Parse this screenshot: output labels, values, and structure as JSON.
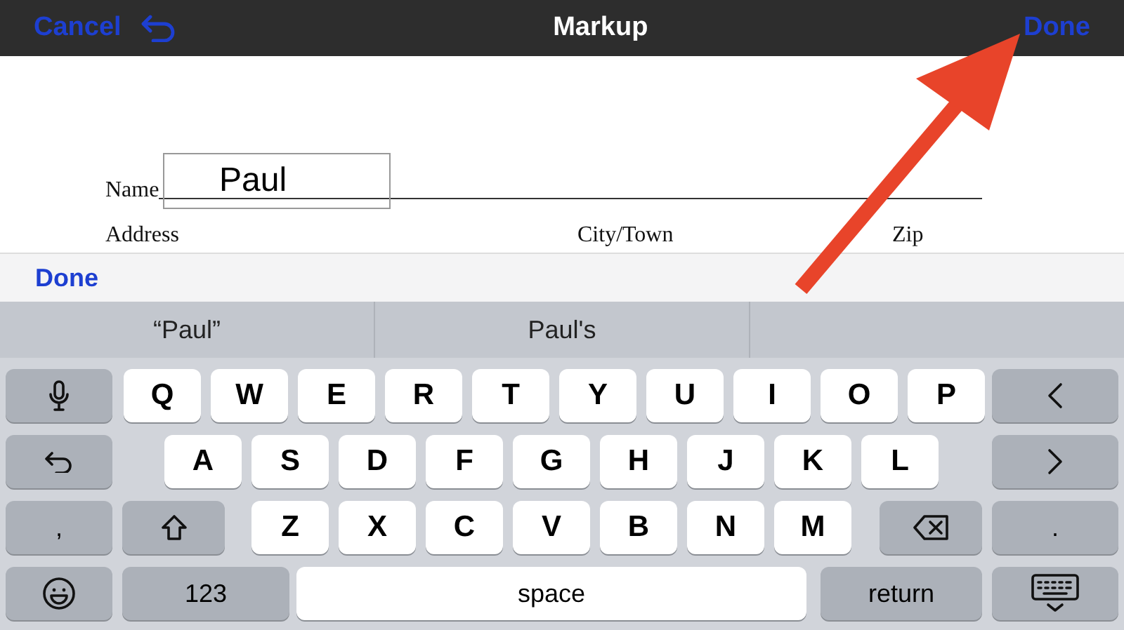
{
  "top_bar": {
    "cancel": "Cancel",
    "title": "Markup",
    "done": "Done"
  },
  "document": {
    "name_label": "Name",
    "name_value": "Paul",
    "labels": [
      "Address",
      "City/Town",
      "Zip"
    ]
  },
  "accessory_bar": {
    "done": "Done"
  },
  "suggestions": [
    "“Paul”",
    "Paul's"
  ],
  "keyboard": [
    [
      {
        "kind": "mic"
      },
      {
        "kind": "letter",
        "label": "Q"
      },
      {
        "kind": "letter",
        "label": "W"
      },
      {
        "kind": "letter",
        "label": "E"
      },
      {
        "kind": "letter",
        "label": "R"
      },
      {
        "kind": "letter",
        "label": "T"
      },
      {
        "kind": "letter",
        "label": "Y"
      },
      {
        "kind": "letter",
        "label": "U"
      },
      {
        "kind": "letter",
        "label": "I"
      },
      {
        "kind": "letter",
        "label": "O"
      },
      {
        "kind": "letter",
        "label": "P"
      },
      {
        "kind": "back"
      }
    ],
    [
      {
        "kind": "undo"
      },
      {
        "kind": "letter",
        "label": "A"
      },
      {
        "kind": "letter",
        "label": "S"
      },
      {
        "kind": "letter",
        "label": "D"
      },
      {
        "kind": "letter",
        "label": "F"
      },
      {
        "kind": "letter",
        "label": "G"
      },
      {
        "kind": "letter",
        "label": "H"
      },
      {
        "kind": "letter",
        "label": "J"
      },
      {
        "kind": "letter",
        "label": "K"
      },
      {
        "kind": "letter",
        "label": "L"
      },
      {
        "kind": "forward"
      }
    ],
    [
      {
        "kind": "function",
        "label": ","
      },
      {
        "kind": "shift"
      },
      {
        "kind": "letter",
        "label": "Z"
      },
      {
        "kind": "letter",
        "label": "X"
      },
      {
        "kind": "letter",
        "label": "C"
      },
      {
        "kind": "letter",
        "label": "V"
      },
      {
        "kind": "letter",
        "label": "B"
      },
      {
        "kind": "letter",
        "label": "N"
      },
      {
        "kind": "letter",
        "label": "M"
      },
      {
        "kind": "delete"
      },
      {
        "kind": "function",
        "label": "."
      }
    ],
    [
      {
        "kind": "emoji"
      },
      {
        "kind": "function",
        "label": "123"
      },
      {
        "kind": "space",
        "label": "space"
      },
      {
        "kind": "function",
        "label": "return"
      },
      {
        "kind": "hide"
      }
    ]
  ]
}
